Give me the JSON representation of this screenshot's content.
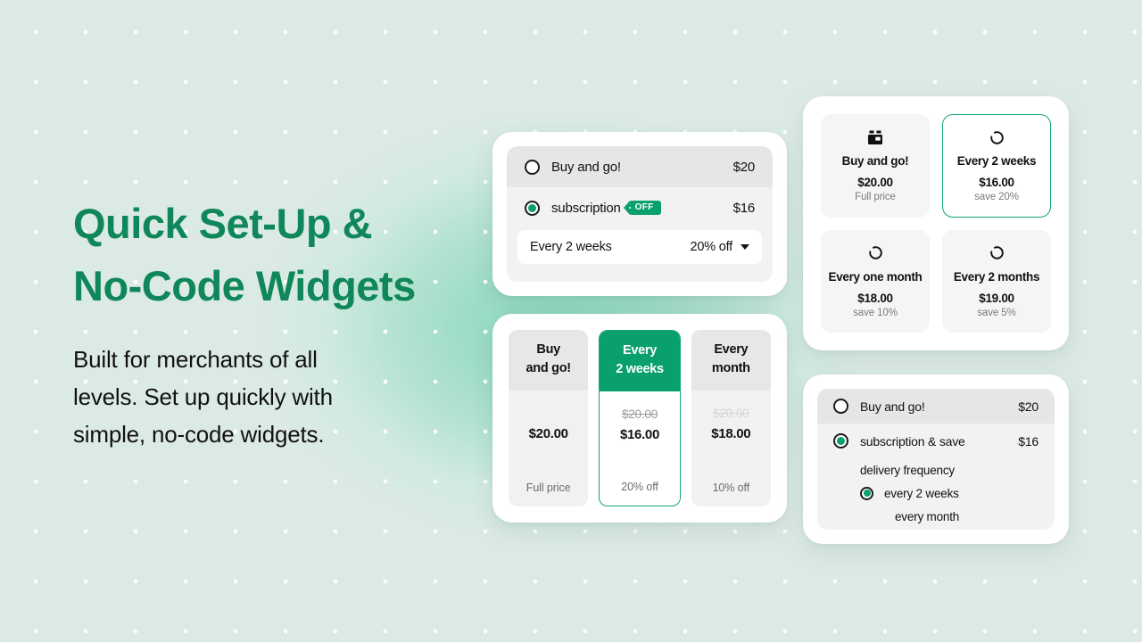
{
  "hero": {
    "headline": "Quick Set-Up &\nNo-Code Widgets",
    "subcopy": "Built for merchants of all\nlevels. Set up quickly with\nsimple, no-code widgets."
  },
  "colors": {
    "brand_green": "#0f875a",
    "accent_green": "#0aa06e",
    "selected_border": "#13a478",
    "background_mint": "#dceae5",
    "glow_mint": "#8fd9bf"
  },
  "widget_radio_select": {
    "options": [
      {
        "label": "Buy and go!",
        "price": "$20",
        "selected": false,
        "badge": null
      },
      {
        "label": "subscription",
        "price": "$16",
        "selected": true,
        "badge": "OFF"
      }
    ],
    "select": {
      "value": "Every 2 weeks",
      "discount": "20% off",
      "chevron": "chevron-down-icon"
    }
  },
  "widget_columns": {
    "columns": [
      {
        "title": "Buy\nand go!",
        "old_price": "",
        "price": "$20.00",
        "note": "Full price",
        "selected": false,
        "old_price_style": "blank"
      },
      {
        "title": "Every\n2 weeks",
        "old_price": "$20.00",
        "price": "$16.00",
        "note": "20% off",
        "selected": true,
        "old_price_style": "normal"
      },
      {
        "title": "Every\nmonth",
        "old_price": "$20.00",
        "price": "$18.00",
        "note": "10% off",
        "selected": false,
        "old_price_style": "faint"
      }
    ]
  },
  "widget_grid": {
    "tiles": [
      {
        "icon": "shopping-basket-icon",
        "title": "Buy and go!",
        "price": "$20.00",
        "save": "Full price",
        "selected": false
      },
      {
        "icon": "refresh-icon",
        "title": "Every 2 weeks",
        "price": "$16.00",
        "save": "save 20%",
        "selected": true
      },
      {
        "icon": "refresh-icon",
        "title": "Every one month",
        "price": "$18.00",
        "save": "save 10%",
        "selected": false
      },
      {
        "icon": "refresh-icon",
        "title": "Every 2 months",
        "price": "$19.00",
        "save": "save 5%",
        "selected": false
      }
    ]
  },
  "widget_nested": {
    "options": [
      {
        "label": "Buy and go!",
        "price": "$20",
        "selected": false
      },
      {
        "label": "subscription & save",
        "price": "$16",
        "selected": true
      }
    ],
    "sub_heading": "delivery frequency",
    "frequencies": [
      {
        "label": "every 2 weeks",
        "selected": true
      },
      {
        "label": "every month",
        "selected": false
      }
    ]
  }
}
